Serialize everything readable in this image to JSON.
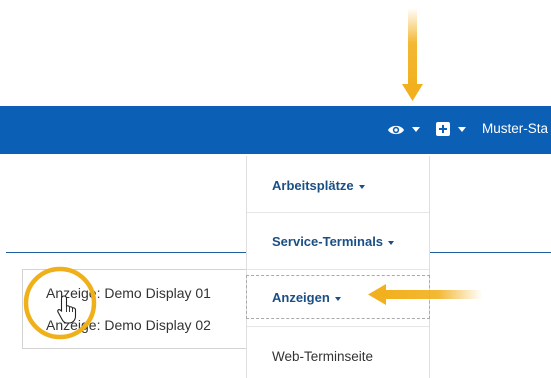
{
  "navbar": {
    "eye_icon": "eye-icon",
    "plus_icon": "plus-square-icon",
    "user_label": "Muster-Sta"
  },
  "dropdown_list": {
    "options": [
      "Anzeige: Demo Display 01",
      "Anzeige: Demo Display 02"
    ]
  },
  "menu": {
    "items": [
      {
        "label": "Arbeitsplätze",
        "has_caret": true
      },
      {
        "label": "Service-Terminals",
        "has_caret": true
      },
      {
        "label": "Anzeigen",
        "has_caret": true
      },
      {
        "label": "Web-Terminseite",
        "has_caret": false
      }
    ]
  },
  "annotations": {
    "arrow_color": "#f2b01e",
    "highlight_circle_color": "#f0b01a",
    "cursor_icon": "hand-pointer-icon"
  },
  "colors": {
    "navbar": "#0b5fb4",
    "menu_link": "#1a4f86"
  }
}
